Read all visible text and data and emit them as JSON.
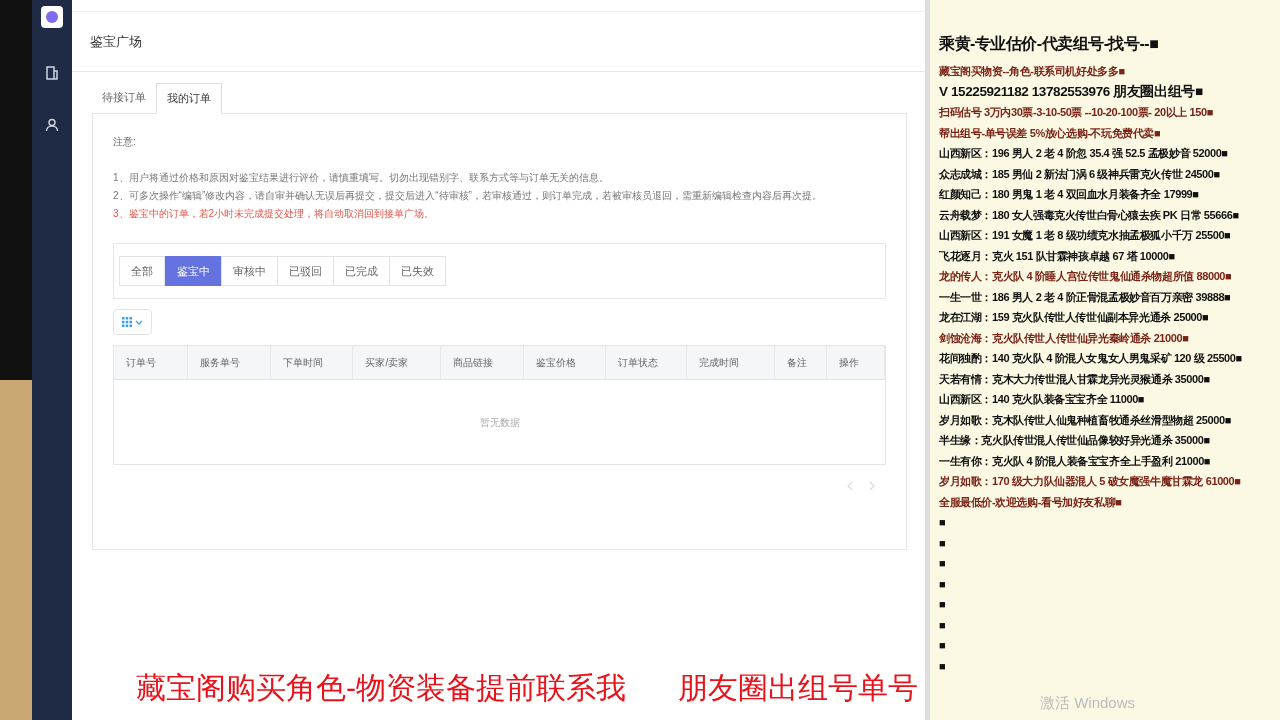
{
  "page_title": "鉴宝广场",
  "tabs": [
    {
      "label": "待接订单",
      "selected": false
    },
    {
      "label": "我的订单",
      "selected": true
    }
  ],
  "notice": {
    "heading": "注意:",
    "items": [
      {
        "text": "1、用户将通过价格和原因对鉴宝结果进行评价，请慎重填写。切勿出现错别字、联系方式等与订单无关的信息。",
        "warning": false
      },
      {
        "text": "2、可多次操作“编辑”修改内容，请自审并确认无误后再提交，提交后进入“待审核”，若审核通过，则订单完成，若被审核员退回，需重新编辑检查内容后再次提。",
        "warning": false
      },
      {
        "text": "3、鉴宝中的订单，若2小时未完成提交处理，将自动取消回到接单广场。",
        "warning": true
      }
    ]
  },
  "filters": [
    {
      "label": "全部",
      "selected": false
    },
    {
      "label": "鉴宝中",
      "selected": true
    },
    {
      "label": "审核中",
      "selected": false
    },
    {
      "label": "已驳回",
      "selected": false
    },
    {
      "label": "已完成",
      "selected": false
    },
    {
      "label": "已失效",
      "selected": false
    }
  ],
  "table": {
    "columns": [
      "订单号",
      "服务单号",
      "下单时间",
      "买家/卖家",
      "商品链接",
      "鉴宝价格",
      "订单状态",
      "完成时间",
      "备注",
      "操作"
    ],
    "empty_text": "暂无数据"
  },
  "notepad": {
    "title": "乘黄-专业估价-代卖组号-找号--■",
    "lines": [
      {
        "text": "藏宝阁买物资--角色-联系司机好处多多■",
        "color": "#7a2418",
        "emphasis": false
      },
      {
        "text": "V 15225921182   13782553976 朋友圈出组号■",
        "color": "#111111",
        "emphasis": true
      },
      {
        "text": "扫码估号 3万内30票-3-10-50票 --10-20-100票- 20以上 150■",
        "color": "#7a2418",
        "emphasis": false
      },
      {
        "text": "帮出组号-单号误差 5%放心选购-不玩免费代卖■",
        "color": "#7a2418",
        "emphasis": false
      },
      {
        "text": "山西新区：196 男人 2 老 4 阶忽 35.4 强 52.5 孟极妙音 52000■",
        "color": "#111111",
        "emphasis": false
      },
      {
        "text": "众志成城：185 男仙 2 新法门涡 6 级神兵雷克火传世 24500■",
        "color": "#111111",
        "emphasis": false
      },
      {
        "text": "红颜知己：180 男鬼 1 老 4 双回血水月装备齐全 17999■",
        "color": "#111111",
        "emphasis": false
      },
      {
        "text": "云舟载梦：180 女人强毒克火传世白骨心猿去疾 PK 日常 55666■",
        "color": "#111111",
        "emphasis": false
      },
      {
        "text": "山西新区：191 女魔 1 老 8 级功绩克水抽孟极狐小千万 25500■",
        "color": "#111111",
        "emphasis": false
      },
      {
        "text": "飞花逐月：克火 151 队甘霖神孩卓越 67 塔 10000■",
        "color": "#111111",
        "emphasis": false
      },
      {
        "text": "龙的传人：克火队 4 阶睡人宫位传世鬼仙通杀物超所值 88000■",
        "color": "#7a2418",
        "emphasis": false
      },
      {
        "text": "一生一世：186 男人 2 老 4 阶正骨混孟极妙音百万亲密 39888■",
        "color": "#111111",
        "emphasis": false
      },
      {
        "text": "龙在江湖：159 克火队传世人传世仙副本异光通杀 25000■",
        "color": "#111111",
        "emphasis": false
      },
      {
        "text": "剑蚀沧海：克火队传世人传世仙异光秦岭通杀 21000■",
        "color": "#7a2418",
        "emphasis": false
      },
      {
        "text": "花间独酌：140 克火队 4 阶混人女鬼女人男鬼采矿 120 级 25500■",
        "color": "#111111",
        "emphasis": false
      },
      {
        "text": "天若有情：克木大力传世混人甘霖龙异光灵猴通杀 35000■",
        "color": "#111111",
        "emphasis": false
      },
      {
        "text": "山西新区：140 克火队装备宝宝齐全 11000■",
        "color": "#111111",
        "emphasis": false
      },
      {
        "text": "岁月如歌：克木队传世人仙鬼种植畜牧通杀丝滑型物超 25000■",
        "color": "#111111",
        "emphasis": false
      },
      {
        "text": "半生缘：克火队传世混人传世仙品像较好异光通杀 35000■",
        "color": "#111111",
        "emphasis": false
      },
      {
        "text": "一生有你：克火队 4 阶混人装备宝宝齐全上手盈利 21000■",
        "color": "#111111",
        "emphasis": false
      },
      {
        "text": "岁月如歌：170 级大力队仙器混人 5 破女魔强牛魔甘霖龙 61000■",
        "color": "#7a2418",
        "emphasis": false
      },
      {
        "text": "全服最低价-欢迎选购-看号加好友私聊■",
        "color": "#7a2418",
        "emphasis": false
      },
      {
        "text": "■",
        "color": "#111111",
        "emphasis": false
      },
      {
        "text": "■",
        "color": "#111111",
        "emphasis": false
      },
      {
        "text": "■",
        "color": "#111111",
        "emphasis": false
      },
      {
        "text": "■",
        "color": "#111111",
        "emphasis": false
      },
      {
        "text": "■",
        "color": "#111111",
        "emphasis": false
      },
      {
        "text": "■",
        "color": "#111111",
        "emphasis": false
      },
      {
        "text": "■",
        "color": "#111111",
        "emphasis": false
      },
      {
        "text": "■",
        "color": "#111111",
        "emphasis": false
      }
    ]
  },
  "overlay_captions": [
    "藏宝阁购买角色-物资装备提前联系我",
    "朋友圈出组号单号"
  ],
  "os_notice": "激活 Windows"
}
